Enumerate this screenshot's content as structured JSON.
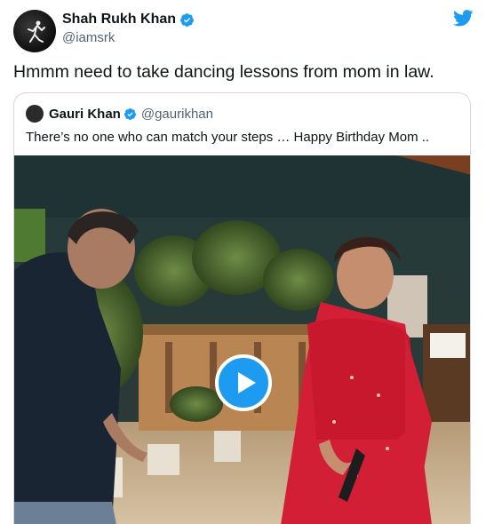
{
  "author": {
    "name": "Shah Rukh Khan",
    "handle": "@iamsrk",
    "verified": true
  },
  "tweet_text": "Hmmm need to take dancing lessons from mom in law.",
  "quoted": {
    "name": "Gauri Khan",
    "handle": "@gaurikhan",
    "verified": true,
    "text": "There’s no one who can match your steps … Happy Birthday Mom .."
  },
  "colors": {
    "accent": "#1d9bf0",
    "secondary_text": "#536471"
  },
  "icons": {
    "brand": "twitter-bird-icon",
    "verified": "verified-badge-icon",
    "play": "play-icon"
  }
}
